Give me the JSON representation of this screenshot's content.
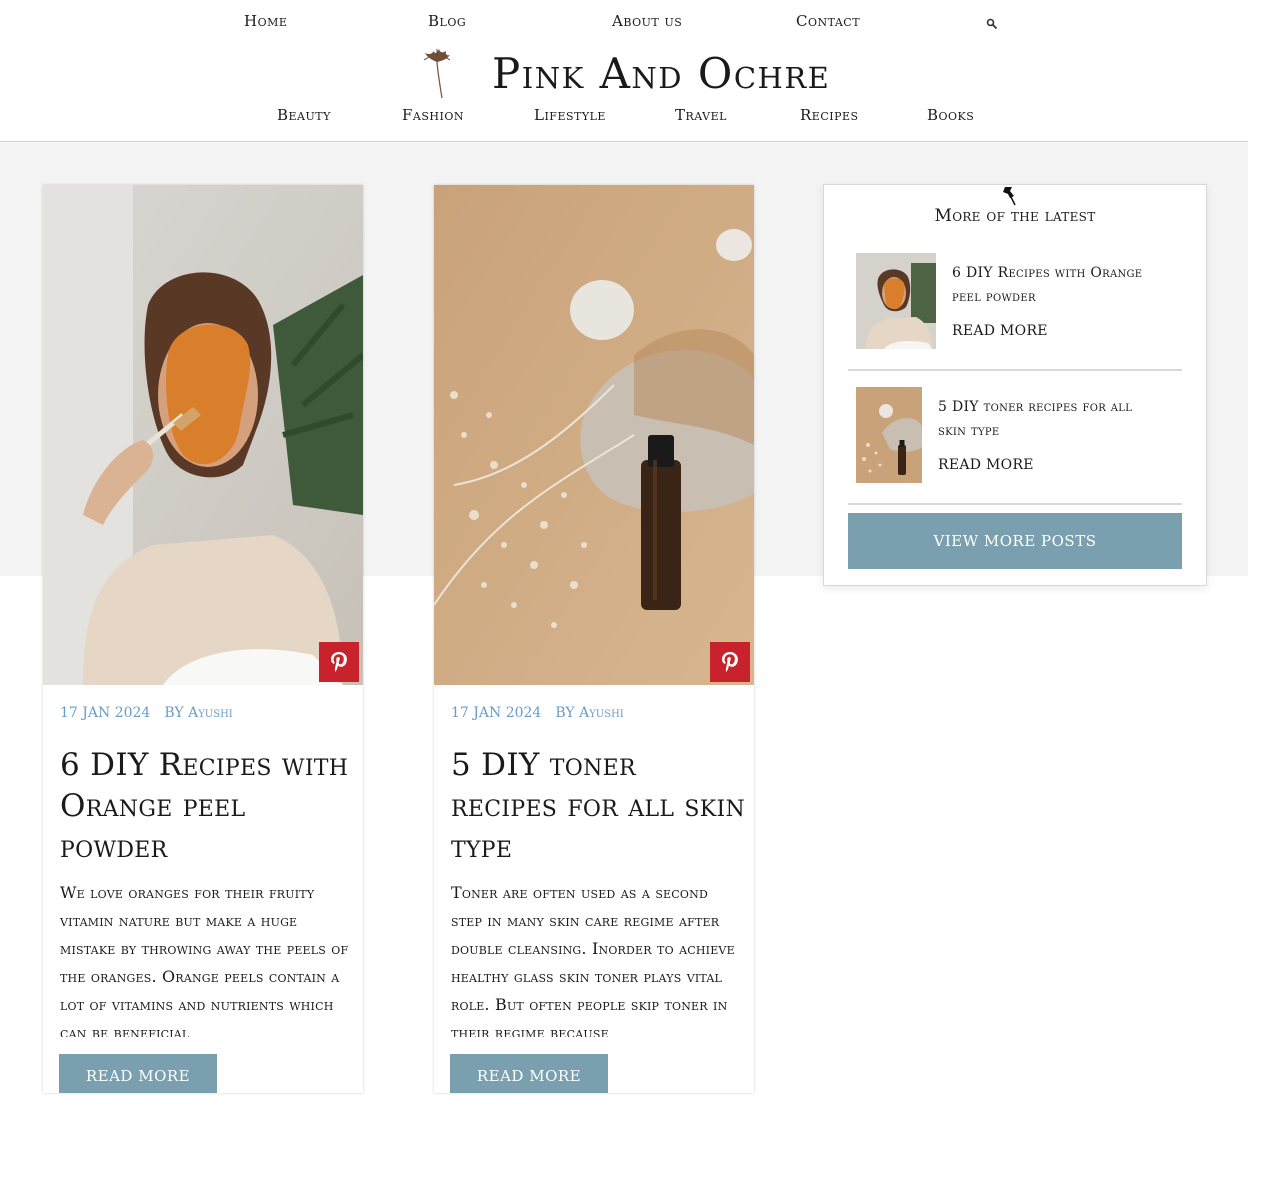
{
  "topnav": {
    "items": [
      "Home",
      "Blog",
      "About us",
      "Contact"
    ],
    "search_icon": "search-icon"
  },
  "brand": {
    "title": "Pink And Ochre",
    "logo_icon": "dried-flower-icon"
  },
  "categories": [
    "Beauty",
    "Fashion",
    "Lifestyle",
    "Travel",
    "Recipes",
    "Books"
  ],
  "posts": [
    {
      "date": "17 JAN 2024",
      "by": "BY",
      "author": "Ayushi",
      "title": "6 DIY Recipes with Orange peel powder",
      "excerpt": "We love oranges for their fruity vitamin nature but make a huge mistake by throwing away the peels of the oranges. Orange peels contain a lot of vitamins and nutrients which can be beneficial",
      "read_more": "READ MORE",
      "pin_icon": "pinterest-icon"
    },
    {
      "date": "17 JAN 2024",
      "by": "BY",
      "author": "Ayushi",
      "title": "5 DIY toner recipes for all skin type",
      "excerpt": "Toner are often used as a second step in many skin care regime after double cleansing. Inorder to achieve healthy glass skin toner plays vital role. But often people skip toner in their regime because",
      "read_more": "READ MORE",
      "pin_icon": "pinterest-icon"
    }
  ],
  "sidebar": {
    "title": "More of the latest",
    "pin_icon": "pushpin-icon",
    "items": [
      {
        "title": "6 DIY Recipes with Orange peel powder",
        "read_more": "READ MORE"
      },
      {
        "title": "5 DIY toner recipes for all skin type",
        "read_more": "READ MORE"
      }
    ],
    "view_more": "VIEW MORE POSTS"
  },
  "colors": {
    "accent_button": "#7aa0b0",
    "meta_text": "#6a9cc8",
    "pinterest": "#c8232c",
    "band": "#f3f3f3"
  }
}
